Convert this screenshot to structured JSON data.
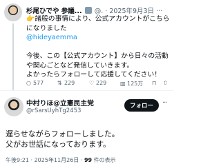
{
  "parent_tweet": {
    "author_name": "杉尾ひでや 参議...",
    "sep": "@.",
    "date": "2025年9月3日",
    "more": "···",
    "lines": [
      "諸般の事情により、公式アカウントがこちら",
      "になりました",
      "@hideyaemma",
      "",
      "今後、この【公式アカウント】から日々の活動",
      "や関心ごとなど発信していきます。",
      "よかったらフォローして応援してください！"
    ],
    "emoji": "👉",
    "stats": {
      "replies": "577",
      "reposts": "229",
      "likes": "229",
      "views": "125万"
    }
  },
  "reply_tweet": {
    "author_name": "中村りほ@立憲民主党",
    "handle": "@rSarsUyhTg2453",
    "follow_label": "フォロー",
    "more": "···",
    "lines": [
      "遅らせながらフォローしました。",
      "父がお世話になっております。"
    ],
    "timestamp": "午後9:21 · 2025年11月26日 · ",
    "views_count": "99",
    "views_label": " 件の表示"
  }
}
